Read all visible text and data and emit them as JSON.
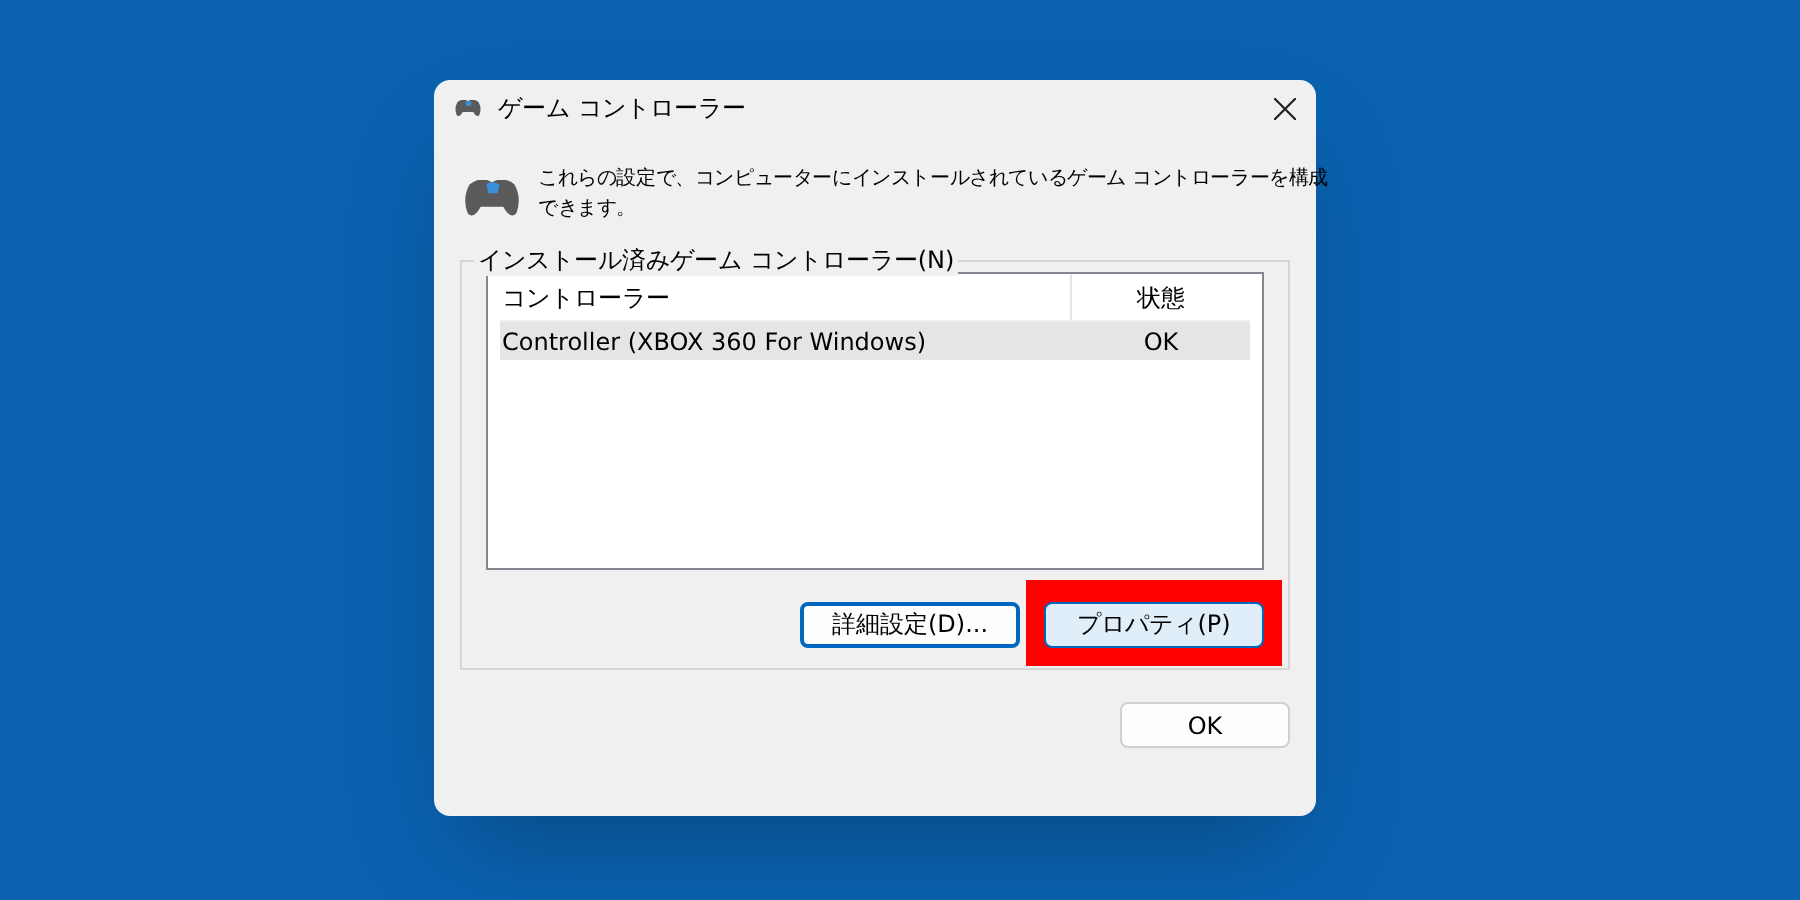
{
  "window": {
    "title": "ゲーム コントローラー"
  },
  "description": [
    "これらの設定で、コンピューターにインストールされているゲーム コントローラーを構成",
    "できます。"
  ],
  "group": {
    "label": "インストール済みゲーム コントローラー(N)",
    "table": {
      "columns": [
        "コントローラー",
        "状態"
      ],
      "rows": [
        {
          "cells": [
            "Controller (XBOX 360 For Windows)",
            "OK"
          ],
          "selected": true
        }
      ]
    },
    "buttons": [
      {
        "label": "詳細設定(D)...",
        "highlighted": false,
        "default": true
      },
      {
        "label": "プロパティ(P)",
        "highlighted": true,
        "default": false
      }
    ]
  },
  "ok_button": {
    "label": "OK"
  }
}
